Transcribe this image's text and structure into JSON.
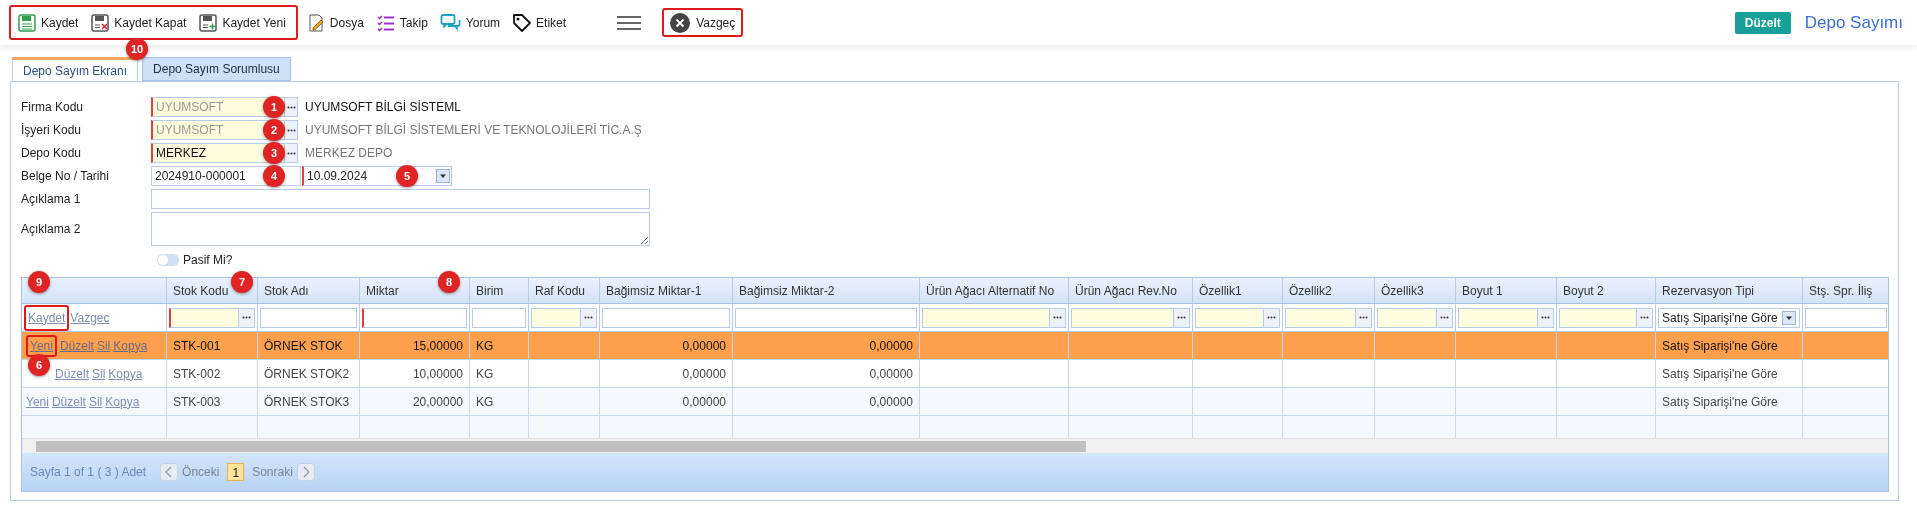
{
  "toolbar": {
    "items": [
      {
        "kind": "save",
        "label": "Kaydet"
      },
      {
        "kind": "save-close",
        "label": "Kaydet Kapat"
      },
      {
        "kind": "save-new",
        "label": "Kaydet Yeni"
      },
      {
        "kind": "file",
        "label": "Dosya"
      },
      {
        "kind": "list",
        "label": "Takip"
      },
      {
        "kind": "comment",
        "label": "Yorum"
      },
      {
        "kind": "tag",
        "label": "Etiket"
      }
    ],
    "cancel": "Vazgeç",
    "edit_button": "Düzelt",
    "page_title": "Depo Sayımı"
  },
  "tabs": [
    {
      "label": "Depo Sayım Ekranı",
      "selected": true
    },
    {
      "label": "Depo Sayım Sorumlusu",
      "selected": false
    }
  ],
  "form": {
    "fields": [
      {
        "label": "Firma Kodu",
        "kind": "lookup",
        "value": "UYUMSOFT",
        "disabled": true,
        "required": true,
        "description": "UYUMSOFT BİLGİ SİSTEML",
        "description_muted": false
      },
      {
        "label": "İşyeri Kodu",
        "kind": "lookup",
        "value": "UYUMSOFT",
        "disabled": true,
        "required": true,
        "description": "UYUMSOFT BİLGİ SİSTEMLERİ VE TEKNOLOJİLERİ TİC.A.Ş",
        "description_muted": true
      },
      {
        "label": "Depo Kodu",
        "kind": "lookup",
        "value": "MERKEZ",
        "disabled": false,
        "required": true,
        "description": "MERKEZ DEPO",
        "description_muted": true
      },
      {
        "label": "Belge No / Tarihi",
        "kind": "doc-date",
        "value": "2024910-000001",
        "date": "10.09.2024"
      },
      {
        "label": "Açıklama 1",
        "kind": "text"
      },
      {
        "label": "Açıklama 2",
        "kind": "textarea"
      }
    ],
    "passive": {
      "label": "Pasif Mi?",
      "on": false
    }
  },
  "grid": {
    "columns": [
      {
        "filter": {
          "kind": "actions",
          "links": [
            "Kaydet",
            "Vazgec"
          ]
        }
      },
      {
        "label": "Stok Kodu",
        "filter": {
          "kind": "lookup",
          "required": true
        }
      },
      {
        "label": "Stok Adı",
        "filter": {
          "kind": "text",
          "required": false
        }
      },
      {
        "label": "Miktar",
        "filter": {
          "kind": "text",
          "required": true
        }
      },
      {
        "label": "Birim",
        "filter": {
          "kind": "text",
          "required": false
        }
      },
      {
        "label": "Raf Kodu",
        "filter": {
          "kind": "lookup",
          "required": false
        }
      },
      {
        "label": "Bağimsiz Miktar-1",
        "filter": {
          "kind": "text",
          "required": false
        }
      },
      {
        "label": "Bağimsiz Miktar-2",
        "filter": {
          "kind": "text",
          "required": false
        }
      },
      {
        "label": "Ürün Ağacı Alternatif No",
        "filter": {
          "kind": "lookup",
          "required": false
        }
      },
      {
        "label": "Ürün Ağacı Rev.No",
        "filter": {
          "kind": "lookup",
          "required": false
        }
      },
      {
        "label": "Özellik1",
        "filter": {
          "kind": "lookup",
          "required": false
        }
      },
      {
        "label": "Özellik2",
        "filter": {
          "kind": "lookup",
          "required": false
        }
      },
      {
        "label": "Özellik3",
        "filter": {
          "kind": "lookup",
          "required": false
        }
      },
      {
        "label": "Boyut 1",
        "filter": {
          "kind": "lookup",
          "required": false
        }
      },
      {
        "label": "Boyut 2",
        "filter": {
          "kind": "lookup",
          "required": false
        }
      },
      {
        "label": "Rezervasyon Tipi",
        "filter": {
          "kind": "select",
          "value": "Satış Siparişi'ne Göre"
        }
      },
      {
        "label": "Stş. Spr. İliş",
        "filter": {
          "kind": "text",
          "required": false
        }
      }
    ],
    "rows": [
      {
        "selected": true,
        "actions": [
          "Yeni",
          "Düzelt",
          "Sil",
          "Kopya"
        ],
        "cells": [
          "",
          "STK-001",
          "ÖRNEK STOK",
          "15,00000",
          "KG",
          "",
          "0,00000",
          "0,00000",
          "",
          "",
          "",
          "",
          "",
          "",
          "",
          "Satış Siparişi'ne Göre",
          ""
        ]
      },
      {
        "selected": false,
        "actions": [
          "Düzelt",
          "Sil",
          "Kopya"
        ],
        "cells": [
          "",
          "STK-002",
          "ÖRNEK STOK2",
          "10,00000",
          "KG",
          "",
          "0,00000",
          "0,00000",
          "",
          "",
          "",
          "",
          "",
          "",
          "",
          "Satış Siparişi'ne Göre",
          ""
        ]
      },
      {
        "selected": false,
        "actions": [
          "Yeni",
          "Düzelt",
          "Sil",
          "Kopya"
        ],
        "cells": [
          "",
          "STK-003",
          "ÖRNEK STOK3",
          "20,00000",
          "KG",
          "",
          "0,00000",
          "0,00000",
          "",
          "",
          "",
          "",
          "",
          "",
          "",
          "Satış Siparişi'ne Göre",
          ""
        ]
      }
    ],
    "pager": {
      "summary": "Sayfa 1 of 1 ( 3 ) Adet",
      "previous": "Önceki",
      "pages": [
        {
          "label": "1",
          "selected": true
        }
      ],
      "next": "Sonraki"
    }
  },
  "callouts": [
    "10",
    "1",
    "2",
    "3",
    "4",
    "5",
    "9",
    "7",
    "8",
    "6"
  ]
}
